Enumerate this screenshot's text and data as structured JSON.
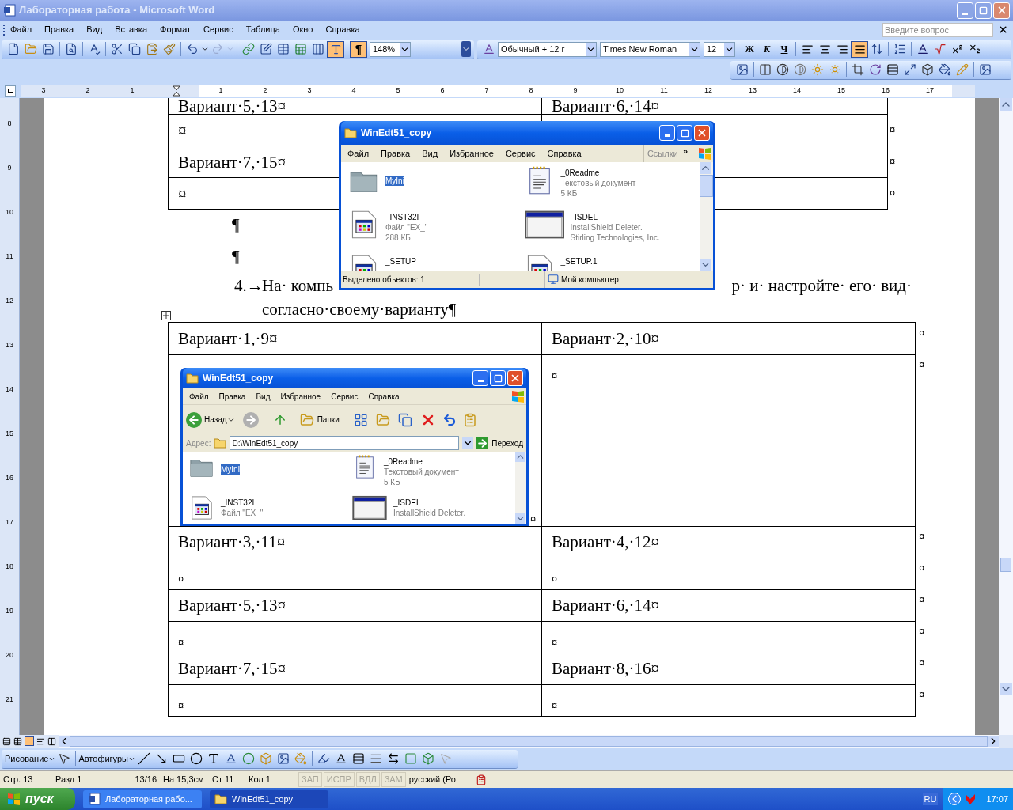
{
  "window": {
    "title": "Лабораторная работа - Microsoft Word"
  },
  "menu": [
    "Файл",
    "Правка",
    "Вид",
    "Вставка",
    "Формат",
    "Сервис",
    "Таблица",
    "Окно",
    "Справка"
  ],
  "help_box": {
    "placeholder": "Введите вопрос"
  },
  "standard_toolbar": {
    "zoom": "148%",
    "pilcrow": {
      "label": "¶",
      "on": true
    },
    "drawing_toggle": {
      "on": true
    }
  },
  "formatting_toolbar": {
    "style": "Обычный + 12 г",
    "font": "Times New Roman",
    "size": "12",
    "text_buttons": [
      "Ж",
      "К",
      "Ч"
    ],
    "align_buttons": [
      {
        "selected": false
      },
      {
        "selected": false
      },
      {
        "selected": false
      },
      {
        "selected": true
      }
    ]
  },
  "ruler": {
    "left_numbers": [
      "3",
      "2",
      "1"
    ],
    "numbers": [
      "1",
      "2",
      "3",
      "4",
      "5",
      "6",
      "7",
      "8",
      "9",
      "10",
      "11",
      "12",
      "13",
      "14",
      "15",
      "16",
      "17"
    ]
  },
  "vertical_ruler": [
    "8",
    "9",
    "10",
    "11",
    "12",
    "13",
    "14",
    "15",
    "16",
    "17",
    "18",
    "19",
    "20",
    "21"
  ],
  "top_table": {
    "rows": [
      {
        "cells": [
          "Вариант·5,·13¤",
          "Вариант·6,·14¤"
        ]
      },
      {
        "cells": [
          "¤",
          ""
        ],
        "end_mark": "¤"
      },
      {
        "cells": [
          "Вариант·7,·15¤",
          ""
        ],
        "end_mark": "¤"
      },
      {
        "cells": [
          "¤",
          ""
        ],
        "end_mark": "¤"
      }
    ]
  },
  "paragraphs": [
    "¶",
    "¶"
  ],
  "list_item": {
    "number": "4.→",
    "visible_start": "На· компь",
    "visible_end": "р· и· настройте· его· вид·",
    "line2": "согласно·своему·варианту¶"
  },
  "table": {
    "rows": [
      {
        "kind": "text",
        "cells": [
          "Вариант·1,·9¤",
          "Вариант·2,·10¤"
        ],
        "end_mark": "¤"
      },
      {
        "kind": "picture",
        "cells": [
          "¤",
          "¤"
        ],
        "end_mark": "¤"
      },
      {
        "kind": "text",
        "cells": [
          "Вариант·3,·11¤",
          "Вариант·4,·12¤"
        ],
        "end_mark": "¤"
      },
      {
        "kind": "text",
        "cells": [
          "¤",
          "¤"
        ],
        "end_mark": "¤"
      },
      {
        "kind": "text",
        "cells": [
          "Вариант·5,·13¤",
          "Вариант·6,·14¤"
        ],
        "end_mark": "¤"
      },
      {
        "kind": "text",
        "cells": [
          "¤",
          "¤"
        ],
        "end_mark": "¤"
      },
      {
        "kind": "text",
        "cells": [
          "Вариант·7,·15¤",
          "Вариант·8,·16¤"
        ],
        "end_mark": "¤"
      },
      {
        "kind": "text",
        "cells": [
          "¤",
          "¤"
        ],
        "end_mark": "¤"
      }
    ]
  },
  "embedded_window": {
    "title": "WinEdt51_copy",
    "menu": [
      "Файл",
      "Правка",
      "Вид",
      "Избранное",
      "Сервис",
      "Справка"
    ],
    "back": "Назад",
    "folders": "Папки",
    "address_label": "Адрес:",
    "address": "D:\\WinEdt51_copy",
    "go": "Переход",
    "items": [
      {
        "name": "MyIni",
        "kind": "folder",
        "selected": true
      },
      {
        "name": "_0Readme",
        "kind": "text",
        "selected": false,
        "details": [
          "Текстовый документ",
          "5 КБ"
        ]
      },
      {
        "name": "_INST32I",
        "kind": "program",
        "selected": false,
        "details": [
          "Файл \"EX_\""
        ]
      },
      {
        "name": "_ISDEL",
        "kind": "window",
        "selected": false,
        "details": [
          "InstallShield Deleter."
        ]
      }
    ]
  },
  "floating_window": {
    "title": "WinEdt51_copy",
    "menu": [
      "Файл",
      "Правка",
      "Вид",
      "Избранное",
      "Сервис",
      "Справка"
    ],
    "links": "Ссылки",
    "chevron": "»",
    "items": [
      {
        "name": "MyIni",
        "kind": "folder",
        "selected": true
      },
      {
        "name": "_0Readme",
        "kind": "text",
        "selected": false,
        "details": [
          "Текстовый документ",
          "5 КБ"
        ]
      },
      {
        "name": "_INST32I",
        "kind": "program",
        "selected": false,
        "details": [
          "Файл \"EX_\"",
          "288 КБ"
        ]
      },
      {
        "name": "_ISDEL",
        "kind": "window",
        "selected": false,
        "details": [
          "InstallShield Deleter.",
          "Stirling Technologies, Inc."
        ]
      },
      {
        "name": "_SETUP",
        "kind": "program",
        "selected": false
      },
      {
        "name": "_SETUP.1",
        "kind": "program",
        "selected": false
      }
    ],
    "status": [
      "Выделено объектов: 1",
      "Мой компьютер"
    ]
  },
  "drawing_toolbar": {
    "draw": "Рисование",
    "autoshapes": "Автофигуры"
  },
  "status_bar": {
    "fields": [
      "Стр. 13",
      "Разд 1",
      "13/16",
      "На 15,3см",
      "Ст 11",
      "Кол 1"
    ],
    "indicators": [
      {
        "text": "ЗАП",
        "on": false
      },
      {
        "text": "ИСПР",
        "on": false
      },
      {
        "text": "ВДЛ",
        "on": false
      },
      {
        "text": "ЗАМ",
        "on": false
      }
    ],
    "language": "русский (Ро"
  },
  "taskbar": {
    "start": "пуск",
    "buttons": [
      {
        "label": "Лабораторная рабо...",
        "kind": "word",
        "selected": false
      },
      {
        "label": "WinEdt51_copy",
        "kind": "folder",
        "selected": true
      }
    ],
    "lang": "RU",
    "clock": "17:07"
  }
}
